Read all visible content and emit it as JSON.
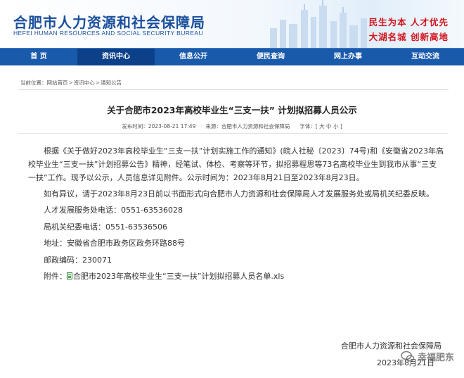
{
  "header": {
    "title_cn": "合肥市人力资源和社会保障局",
    "title_en": "HEFEI HUMAN RESOURCES AND SOCIAL SECURITY BUREAU",
    "slogan_line1": "民生为本  人才优先",
    "slogan_line2": "大湖名城  创新高地"
  },
  "nav": {
    "items": [
      {
        "label": "首  页"
      },
      {
        "label": "资讯中心"
      },
      {
        "label": "信息公开"
      },
      {
        "label": "便民查询"
      },
      {
        "label": "网上办事"
      },
      {
        "label": "互动交流"
      }
    ],
    "active_index": 1
  },
  "breadcrumb": {
    "prefix": "当前位置：",
    "items": [
      "网站首页",
      "资讯中心",
      "通知公告"
    ],
    "separator": ">"
  },
  "article": {
    "title": "关于合肥市2023年高校毕业生“三支一扶” 计划拟招募人员公示",
    "publish_time_label": "发布时间：",
    "publish_time": "2023-08-21 17:49",
    "source_label": "来源：",
    "source": "合肥市人力资源和社会保障局",
    "font_size_label": "字体：",
    "font_size_options": [
      "大",
      "中",
      "小"
    ],
    "paragraph1": "根据《关于做好2023年高校毕业生“三支一扶”计划实施工作的通知》(皖人社秘〔2023〕74号)和《安徽省2023年高校毕业生“三支一扶”计划招募公告》精神，经笔试、体检、考察等环节，拟招募程思等73名高校毕业生到我市从事“三支一扶”工作。现予以公示，人员信息详见附件。公示时间为：2023年8月21日至2023年8月23日。",
    "paragraph2": "如有异议，请于2023年8月23日前以书面形式向合肥市人力资源和社会保障局人才发展服务处或局机关纪委反映。",
    "contact1": "人才发展服务处电话：0551-63536028",
    "contact2": "局机关纪委电话：0551-63536506",
    "address": "地址：安徽省合肥市政务区政务环路88号",
    "postcode": "邮政编码：230071",
    "attachment_label": "附件：",
    "attachment_name": "合肥市2023年高校毕业生“三支一扶”计划拟招募人员名单.xls",
    "sign_org": "合肥市人力资源和社会保障局",
    "sign_date": "2023年8月21日"
  },
  "watermark": {
    "text": "幸福肥东"
  },
  "colors": {
    "nav_bg": "#1a5aab",
    "nav_active": "#0c418a",
    "brand_blue": "#1a4f9c",
    "slogan_red": "#d2141a"
  }
}
